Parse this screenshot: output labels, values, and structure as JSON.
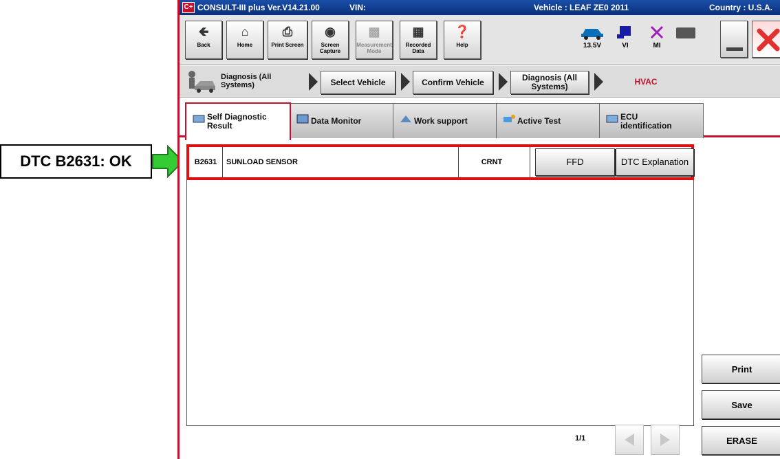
{
  "callout": {
    "text": "DTC B2631: OK"
  },
  "title_bar": {
    "app_title": "CONSULT-III plus  Ver.V14.21.00",
    "vin_label": "VIN:",
    "vehicle": "Vehicle : LEAF ZE0 2011",
    "country": "Country : U.S.A."
  },
  "toolbar": {
    "back": "Back",
    "home": "Home",
    "print_screen": "Print Screen",
    "screen_capture": "Screen Capture",
    "measurement_mode": "Measurement Mode",
    "recorded_data": "Recorded Data",
    "help": "Help",
    "voltage": "13.5V",
    "vi": "VI",
    "mi": "MI"
  },
  "breadcrumb": {
    "current": "Diagnosis (All Systems)",
    "steps": [
      "Select Vehicle",
      "Confirm Vehicle",
      "Diagnosis (All Systems)"
    ],
    "system": "HVAC"
  },
  "tabs": [
    {
      "label": "Self Diagnostic Result",
      "active": true
    },
    {
      "label": "Data Monitor",
      "active": false
    },
    {
      "label": "Work support",
      "active": false
    },
    {
      "label": "Active Test",
      "active": false
    },
    {
      "label": "ECU identification",
      "active": false
    }
  ],
  "dtc_rows": [
    {
      "code": "B2631",
      "description": "SUNLOAD SENSOR",
      "status": "CRNT",
      "ffd_label": "FFD",
      "explanation_label": "DTC Explanation"
    }
  ],
  "side_buttons": {
    "print": "Print",
    "save": "Save",
    "erase": "ERASE"
  },
  "pagination": {
    "indicator": "1/1"
  },
  "colors": {
    "accent_red": "#c8102e",
    "callout_arrow": "#33cc33",
    "highlight_border": "#e01010",
    "title_bar": "#0b2f7a"
  }
}
